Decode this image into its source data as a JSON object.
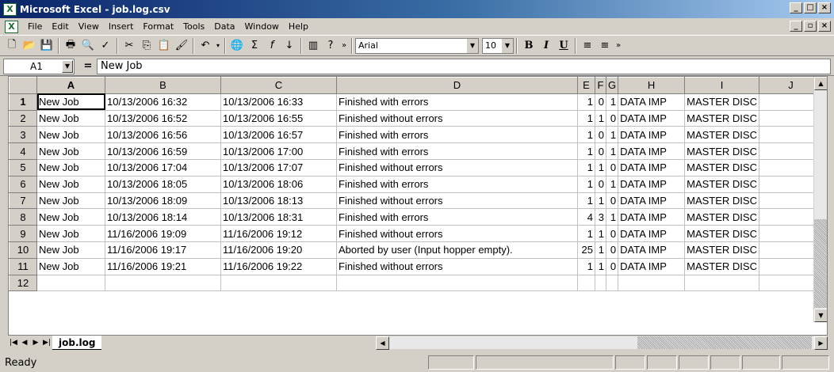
{
  "window": {
    "title": "Microsoft Excel - job.log.csv",
    "app_icon": "X"
  },
  "menu": {
    "items": [
      {
        "label": "File",
        "u": "F",
        "rest": "ile"
      },
      {
        "label": "Edit",
        "u": "E",
        "rest": "dit"
      },
      {
        "label": "View",
        "u": "V",
        "rest": "iew"
      },
      {
        "label": "Insert",
        "u": "I",
        "rest": "nsert"
      },
      {
        "label": "Format",
        "u": "o",
        "pre": "F",
        "rest": "rmat"
      },
      {
        "label": "Tools",
        "u": "T",
        "rest": "ools"
      },
      {
        "label": "Data",
        "u": "D",
        "rest": "ata"
      },
      {
        "label": "Window",
        "u": "W",
        "rest": "indow"
      },
      {
        "label": "Help",
        "u": "H",
        "rest": "elp"
      }
    ]
  },
  "toolbar": {
    "font": "Arial",
    "size": "10",
    "bold": "B",
    "italic": "I",
    "underline": "U"
  },
  "formula": {
    "cell": "A1",
    "eq": "=",
    "content": "New Job"
  },
  "columns": [
    "A",
    "B",
    "C",
    "D",
    "E",
    "F",
    "G",
    "H",
    "I",
    "J"
  ],
  "rows": [
    {
      "n": "1",
      "cells": [
        "New Job",
        "10/13/2006 16:32",
        "10/13/2006 16:33",
        "Finished with errors",
        "1",
        "0",
        "1",
        "DATA IMP",
        "MASTER DISC",
        ""
      ]
    },
    {
      "n": "2",
      "cells": [
        "New Job",
        "10/13/2006 16:52",
        "10/13/2006 16:55",
        "Finished without errors",
        "1",
        "1",
        "0",
        "DATA IMP",
        "MASTER DISC",
        ""
      ]
    },
    {
      "n": "3",
      "cells": [
        "New Job",
        "10/13/2006 16:56",
        "10/13/2006 16:57",
        "Finished with errors",
        "1",
        "0",
        "1",
        "DATA IMP",
        "MASTER DISC",
        ""
      ]
    },
    {
      "n": "4",
      "cells": [
        "New Job",
        "10/13/2006 16:59",
        "10/13/2006 17:00",
        "Finished with errors",
        "1",
        "0",
        "1",
        "DATA IMP",
        "MASTER DISC",
        ""
      ]
    },
    {
      "n": "5",
      "cells": [
        "New Job",
        "10/13/2006 17:04",
        "10/13/2006 17:07",
        "Finished without errors",
        "1",
        "1",
        "0",
        "DATA IMP",
        "MASTER DISC",
        ""
      ]
    },
    {
      "n": "6",
      "cells": [
        "New Job",
        "10/13/2006 18:05",
        "10/13/2006 18:06",
        "Finished with errors",
        "1",
        "0",
        "1",
        "DATA IMP",
        "MASTER DISC",
        ""
      ]
    },
    {
      "n": "7",
      "cells": [
        "New Job",
        "10/13/2006 18:09",
        "10/13/2006 18:13",
        "Finished without errors",
        "1",
        "1",
        "0",
        "DATA IMP",
        "MASTER DISC",
        ""
      ]
    },
    {
      "n": "8",
      "cells": [
        "New Job",
        "10/13/2006 18:14",
        "10/13/2006 18:31",
        "Finished with errors",
        "4",
        "3",
        "1",
        "DATA IMP",
        "MASTER DISC",
        ""
      ]
    },
    {
      "n": "9",
      "cells": [
        "New Job",
        "11/16/2006 19:09",
        "11/16/2006 19:12",
        "Finished without errors",
        "1",
        "1",
        "0",
        "DATA IMP",
        "MASTER DISC",
        ""
      ]
    },
    {
      "n": "10",
      "cells": [
        "New Job",
        "11/16/2006 19:17",
        "11/16/2006 19:20",
        "Aborted by user (Input hopper empty).",
        "25",
        "1",
        "0",
        "DATA IMP",
        "MASTER DISC",
        ""
      ]
    },
    {
      "n": "11",
      "cells": [
        "New Job",
        "11/16/2006 19:21",
        "11/16/2006 19:22",
        "Finished without errors",
        "1",
        "1",
        "0",
        "DATA IMP",
        "MASTER DISC",
        ""
      ]
    },
    {
      "n": "12",
      "cells": [
        "",
        "",
        "",
        "",
        "",
        "",
        "",
        "",
        "",
        ""
      ]
    }
  ],
  "sheet": {
    "tab": "job.log"
  },
  "status": {
    "text": "Ready"
  }
}
